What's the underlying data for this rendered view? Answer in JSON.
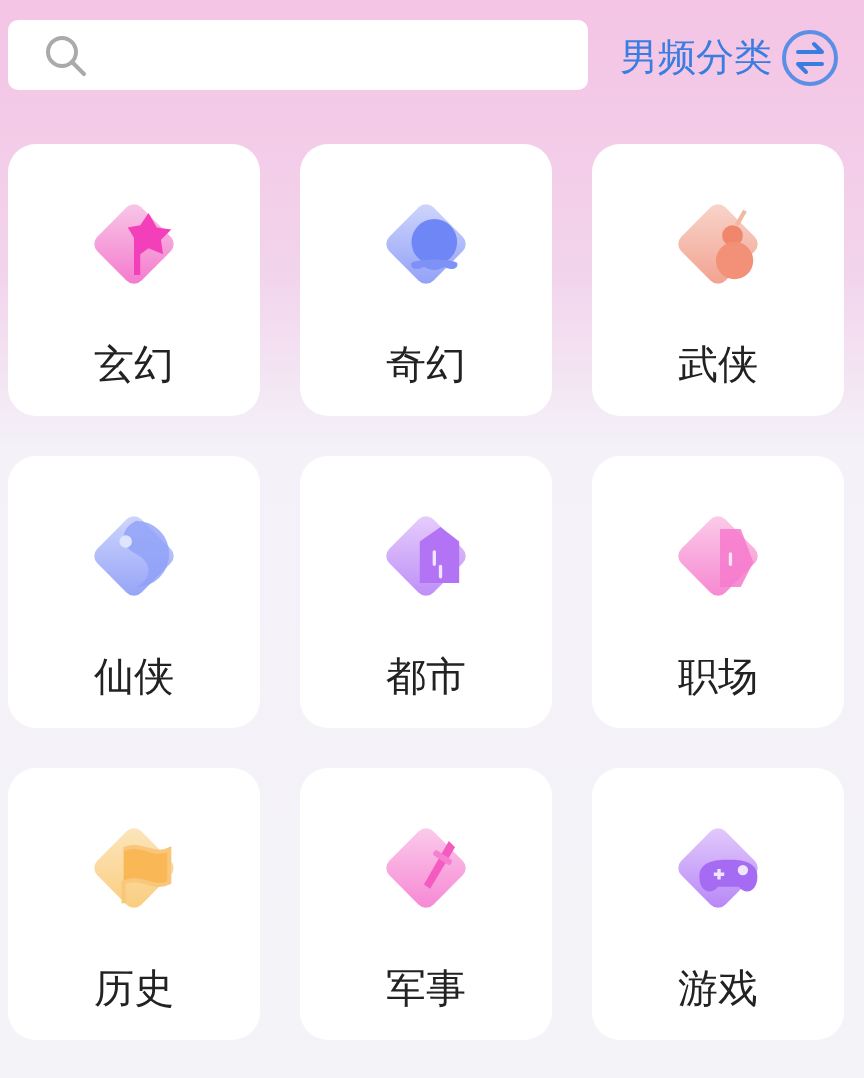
{
  "search": {
    "kind": "search"
  },
  "gender_switch": {
    "label": "男频分类",
    "selected": true
  },
  "categories": [
    {
      "label": "玄幻",
      "kind": "wand"
    },
    {
      "label": "奇幻",
      "kind": "bubble"
    },
    {
      "label": "武侠",
      "kind": "gourd"
    },
    {
      "label": "仙侠",
      "kind": "taiji"
    },
    {
      "label": "都市",
      "kind": "house"
    },
    {
      "label": "职场",
      "kind": "door"
    },
    {
      "label": "历史",
      "kind": "flag"
    },
    {
      "label": "军事",
      "kind": "sword"
    },
    {
      "label": "游戏",
      "kind": "gamepad"
    }
  ]
}
